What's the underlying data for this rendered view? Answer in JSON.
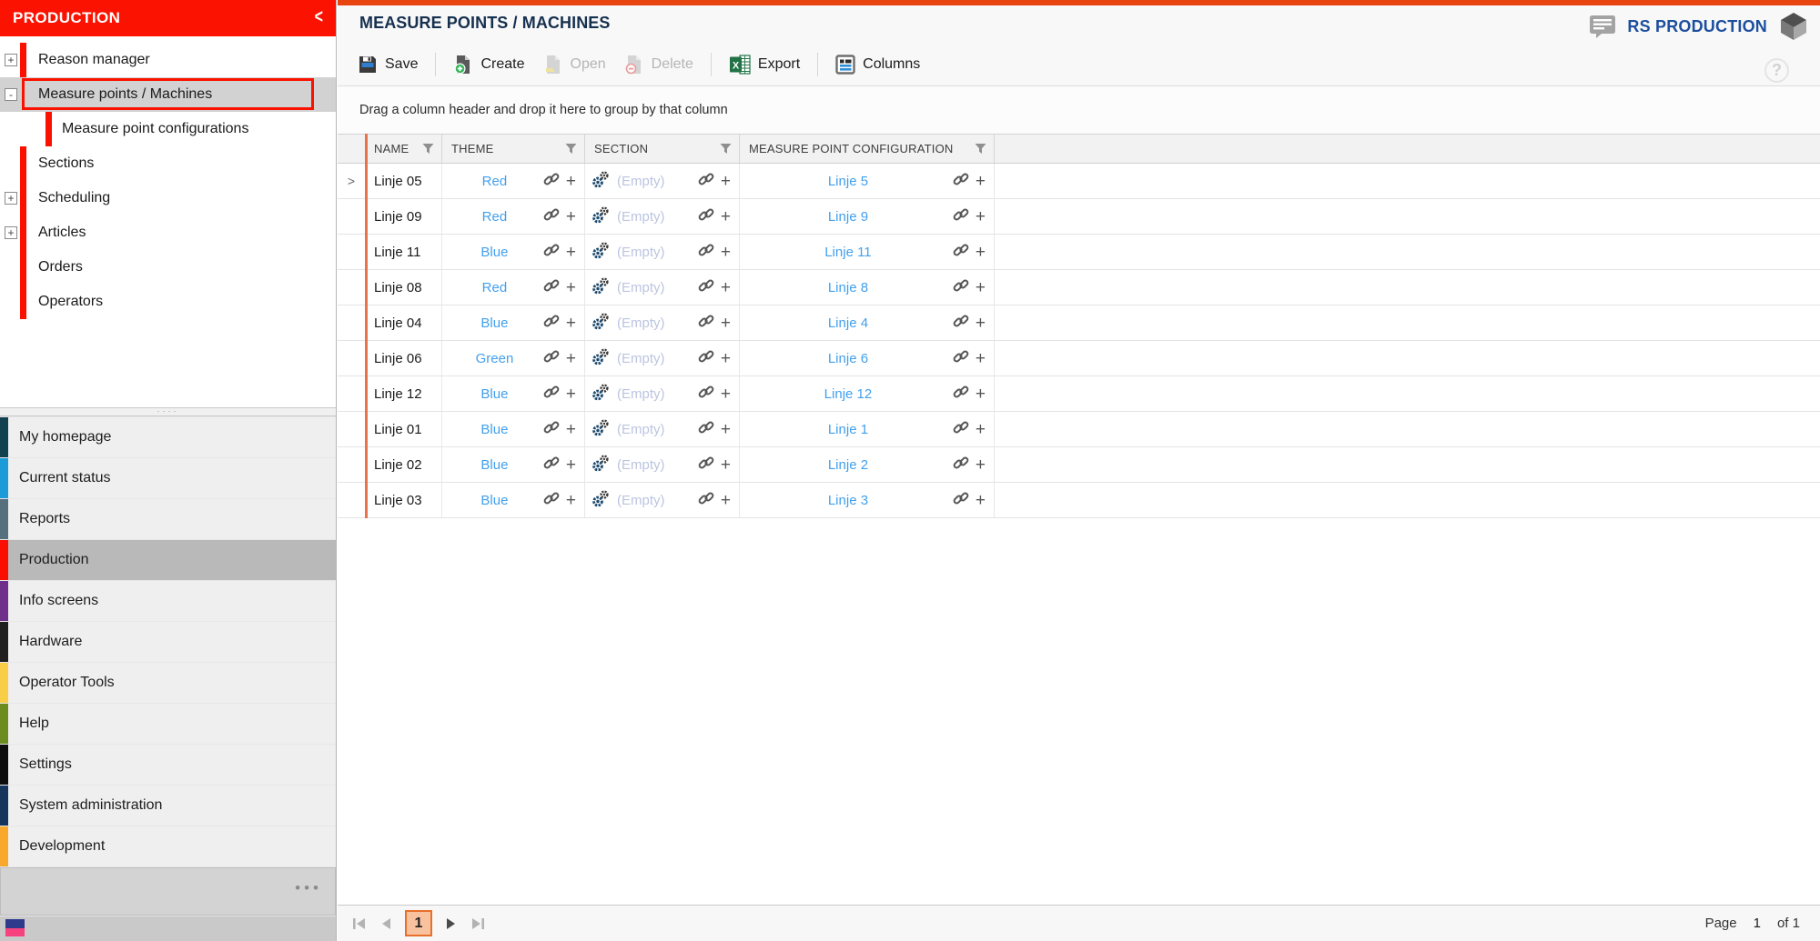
{
  "sidebar": {
    "header": {
      "title": "PRODUCTION",
      "collapse_glyph": "<"
    },
    "tree": [
      {
        "label": "Reason manager",
        "expander": "+",
        "level": 0,
        "selected": false
      },
      {
        "label": "Measure points / Machines",
        "expander": "-",
        "level": 0,
        "selected": true
      },
      {
        "label": "Measure point configurations",
        "expander": "",
        "level": 1,
        "selected": false
      },
      {
        "label": "Sections",
        "expander": "",
        "level": 0,
        "selected": false
      },
      {
        "label": "Scheduling",
        "expander": "+",
        "level": 0,
        "selected": false
      },
      {
        "label": "Articles",
        "expander": "+",
        "level": 0,
        "selected": false
      },
      {
        "label": "Orders",
        "expander": "",
        "level": 0,
        "selected": false
      },
      {
        "label": "Operators",
        "expander": "",
        "level": 0,
        "selected": false
      }
    ],
    "menu": [
      {
        "label": "My homepage",
        "stripe_color": "#11404f",
        "selected": false
      },
      {
        "label": "Current status",
        "stripe_color": "#1b9cd8",
        "selected": false
      },
      {
        "label": "Reports",
        "stripe_color": "#56707d",
        "selected": false
      },
      {
        "label": "Production",
        "stripe_color": "#fb0f00",
        "selected": true
      },
      {
        "label": "Info screens",
        "stripe_color": "#702f8a",
        "selected": false
      },
      {
        "label": "Hardware",
        "stripe_color": "#1f1f1f",
        "selected": false
      },
      {
        "label": "Operator Tools",
        "stripe_color": "#f8ce46",
        "selected": false
      },
      {
        "label": "Help",
        "stripe_color": "#6d8c20",
        "selected": false
      },
      {
        "label": "Settings",
        "stripe_color": "#0d0d0d",
        "selected": false
      },
      {
        "label": "System administration",
        "stripe_color": "#15355c",
        "selected": false
      },
      {
        "label": "Development",
        "stripe_color": "#f9a82b",
        "selected": false
      }
    ],
    "overflow_dots": "•••"
  },
  "header": {
    "title": "MEASURE POINTS / MACHINES",
    "brand": "RS PRODUCTION",
    "help_glyph": "?"
  },
  "toolbar": {
    "buttons": [
      {
        "label": "Save",
        "enabled": true
      },
      {
        "label": "Create",
        "enabled": true
      },
      {
        "label": "Open",
        "enabled": false
      },
      {
        "label": "Delete",
        "enabled": false
      },
      {
        "label": "Export",
        "enabled": true
      },
      {
        "label": "Columns",
        "enabled": true
      }
    ]
  },
  "grid": {
    "group_hint": "Drag a column header and drop it here to group by that column",
    "columns": [
      "NAME",
      "THEME",
      "SECTION",
      "MEASURE POINT CONFIGURATION"
    ],
    "rows": [
      {
        "expander": ">",
        "name": "Linje 05",
        "theme": "Red",
        "section": "(Empty)",
        "config": "Linje 5"
      },
      {
        "expander": "",
        "name": "Linje 09",
        "theme": "Red",
        "section": "(Empty)",
        "config": "Linje 9"
      },
      {
        "expander": "",
        "name": "Linje 11",
        "theme": "Blue",
        "section": "(Empty)",
        "config": "Linje 11"
      },
      {
        "expander": "",
        "name": "Linje 08",
        "theme": "Red",
        "section": "(Empty)",
        "config": "Linje 8"
      },
      {
        "expander": "",
        "name": "Linje 04",
        "theme": "Blue",
        "section": "(Empty)",
        "config": "Linje 4"
      },
      {
        "expander": "",
        "name": "Linje 06",
        "theme": "Green",
        "section": "(Empty)",
        "config": "Linje 6"
      },
      {
        "expander": "",
        "name": "Linje 12",
        "theme": "Blue",
        "section": "(Empty)",
        "config": "Linje 12"
      },
      {
        "expander": "",
        "name": "Linje 01",
        "theme": "Blue",
        "section": "(Empty)",
        "config": "Linje 1"
      },
      {
        "expander": "",
        "name": "Linje 02",
        "theme": "Blue",
        "section": "(Empty)",
        "config": "Linje 2"
      },
      {
        "expander": "",
        "name": "Linje 03",
        "theme": "Blue",
        "section": "(Empty)",
        "config": "Linje 3"
      }
    ]
  },
  "pagination": {
    "page_label": "Page",
    "current_page": "1",
    "of_label": "of 1"
  },
  "colors": {
    "accent_red": "#fb1200",
    "top_strip": "#e8440f",
    "brand_blue": "#1d4f9e",
    "title_navy": "#16304f",
    "grid_link": "#42a0ed",
    "empty_text": "#bcc5e0",
    "orange_row_line": "#e8734a",
    "pager_box_bg": "#f9c29e",
    "pager_box_border": "#e8702c"
  }
}
